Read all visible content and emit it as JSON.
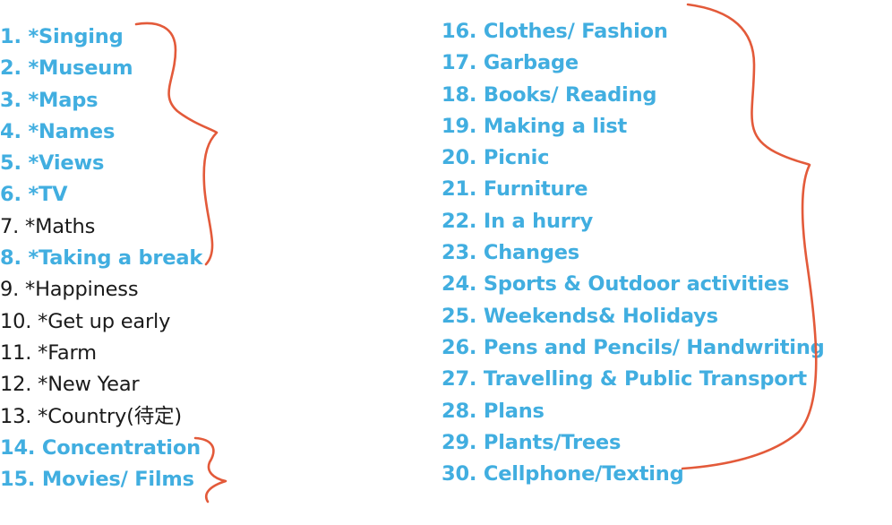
{
  "topics_left": [
    {
      "number": "1.",
      "label": "*Singing",
      "highlighted": true
    },
    {
      "number": "2.",
      "label": "*Museum",
      "highlighted": true
    },
    {
      "number": "3.",
      "label": "*Maps",
      "highlighted": true
    },
    {
      "number": "4.",
      "label": "*Names",
      "highlighted": true
    },
    {
      "number": "5.",
      "label": "*Views",
      "highlighted": true
    },
    {
      "number": "6.",
      "label": "*TV",
      "highlighted": true
    },
    {
      "number": "7.",
      "label": "*Maths",
      "highlighted": false
    },
    {
      "number": "8.",
      "label": "*Taking a break",
      "highlighted": true
    },
    {
      "number": "9.",
      "label": "*Happiness",
      "highlighted": false
    },
    {
      "number": "10.",
      "label": "*Get up early",
      "highlighted": false
    },
    {
      "number": "11.",
      "label": "*Farm",
      "highlighted": false
    },
    {
      "number": "12.",
      "label": "*New Year",
      "highlighted": false
    },
    {
      "number": "13.",
      "label": "*Country(待定)",
      "highlighted": false
    },
    {
      "number": "14.",
      "label": "Concentration",
      "highlighted": true
    },
    {
      "number": "15.",
      "label": "Movies/ Films",
      "highlighted": true
    }
  ],
  "topics_right": [
    {
      "number": "16.",
      "label": "Clothes/ Fashion",
      "highlighted": true
    },
    {
      "number": "17.",
      "label": "Garbage",
      "highlighted": true
    },
    {
      "number": "18.",
      "label": "Books/ Reading",
      "highlighted": true
    },
    {
      "number": "19.",
      "label": "Making a list",
      "highlighted": true
    },
    {
      "number": "20.",
      "label": "Picnic",
      "highlighted": true
    },
    {
      "number": "21.",
      "label": "Furniture",
      "highlighted": true
    },
    {
      "number": "22.",
      "label": "In a hurry",
      "highlighted": true
    },
    {
      "number": "23.",
      "label": "Changes",
      "highlighted": true
    },
    {
      "number": "24.",
      "label": "Sports & Outdoor activities",
      "highlighted": true
    },
    {
      "number": "25.",
      "label": "Weekends& Holidays",
      "highlighted": true
    },
    {
      "number": "26.",
      "label": "Pens and Pencils/ Handwriting",
      "highlighted": true
    },
    {
      "number": "27.",
      "label": "Travelling & Public Transport",
      "highlighted": true
    },
    {
      "number": "28.",
      "label": "Plans",
      "highlighted": true
    },
    {
      "number": "29.",
      "label": "Plants/Trees",
      "highlighted": true
    },
    {
      "number": "30.",
      "label": "Cellphone/Texting",
      "highlighted": true
    }
  ],
  "colors": {
    "highlight_text": "#41aee0",
    "plain_text": "#1a1a1a",
    "bracket_ink": "#e35a3a",
    "background": "#ffffff"
  }
}
